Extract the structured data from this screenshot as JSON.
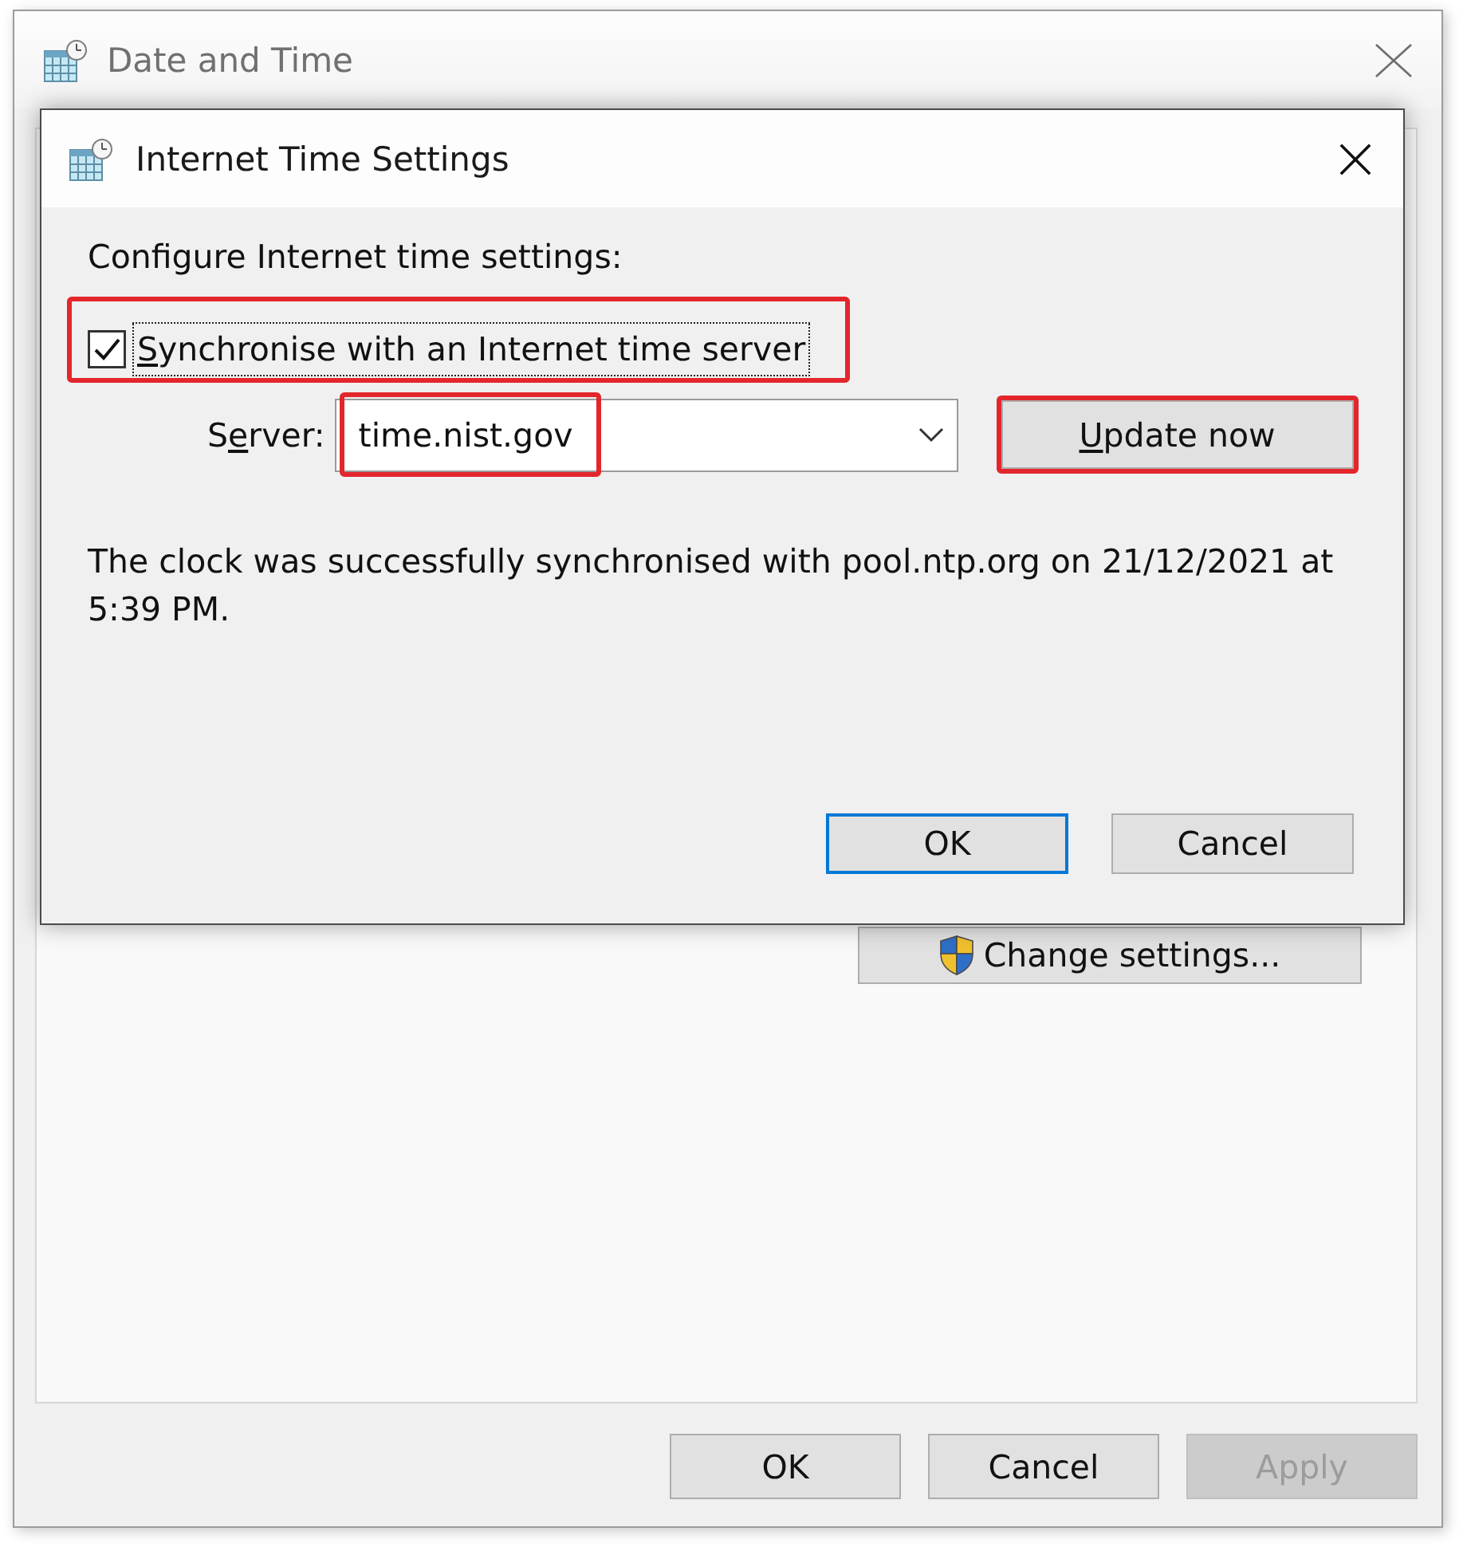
{
  "window": {
    "title": "Date and Time",
    "change_settings_button": {
      "label": "Change settings..."
    },
    "buttons": [
      {
        "label": "OK",
        "disabled": false
      },
      {
        "label": "Cancel",
        "disabled": false
      },
      {
        "label": "Apply",
        "disabled": true
      }
    ]
  },
  "dialog": {
    "title": "Internet Time Settings",
    "heading": "Configure Internet time settings:",
    "sync_checkbox": {
      "access_key": "S",
      "label_rest": "ynchronise with an Internet time server",
      "checked": true,
      "focused": true,
      "highlighted": true
    },
    "server": {
      "label_lead": "S",
      "access_key": "e",
      "label_rest": "rver:",
      "value": "time.nist.gov",
      "value_highlighted": true
    },
    "update_button": {
      "access_key": "U",
      "label_rest": "pdate now",
      "highlighted": true
    },
    "status_message": "The clock was successfully synchronised with pool.ntp.org on 21/12/2021 at 5:39 PM.",
    "buttons": [
      {
        "label": "OK",
        "default": true
      },
      {
        "label": "Cancel",
        "default": false
      }
    ]
  }
}
